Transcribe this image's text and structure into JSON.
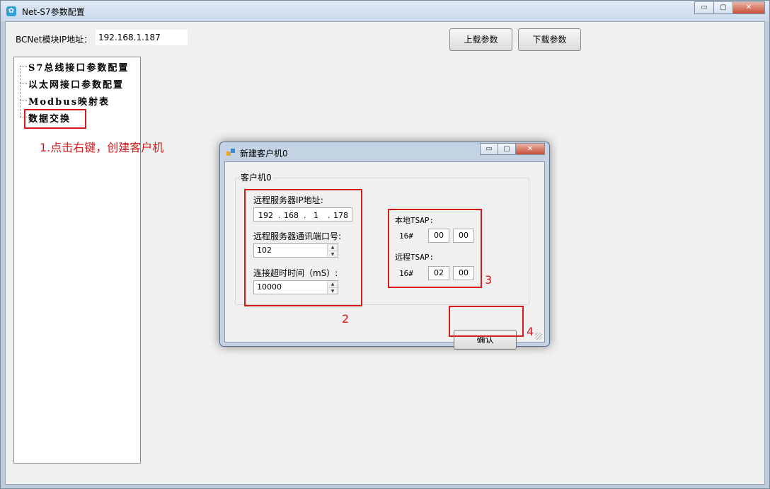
{
  "window": {
    "title": "Net-S7参数配置",
    "icon": "gear-icon",
    "controls": {
      "minimize": "▭",
      "maximize": "▢",
      "close": "✕"
    }
  },
  "toolbar": {
    "ip_label": "BCNet模块IP地址：",
    "ip_value": "192.168.1.187",
    "upload_label": "上载参数",
    "download_label": "下载参数"
  },
  "tree": {
    "items": [
      {
        "label": "S7总线接口参数配置"
      },
      {
        "label": "以太网接口参数配置"
      },
      {
        "label": "Modbus映射表"
      },
      {
        "label": "数据交换"
      }
    ]
  },
  "annotations": {
    "step1": "1.点击右键，创建客户机",
    "step2": "2",
    "step3": "3",
    "step4": "4",
    "color": "#d21c1c"
  },
  "dialog": {
    "title": "新建客户机0",
    "group_label": "客户机0",
    "remote_ip_label": "远程服务器IP地址:",
    "remote_ip": {
      "o1": "192",
      "o2": "168",
      "o3": "1",
      "o4": "178",
      "dot": "."
    },
    "port_label": "远程服务器通讯端口号:",
    "port_value": "102",
    "timeout_label": "连接超时时间（mS）:",
    "timeout_value": "10000",
    "local_tsap_label": "本地TSAP:",
    "local_prefix": "16#",
    "local_tsap": [
      "00",
      "00"
    ],
    "remote_tsap_label": "远程TSAP:",
    "remote_prefix": "16#",
    "remote_tsap": [
      "02",
      "00"
    ],
    "ok_label": "确认"
  }
}
